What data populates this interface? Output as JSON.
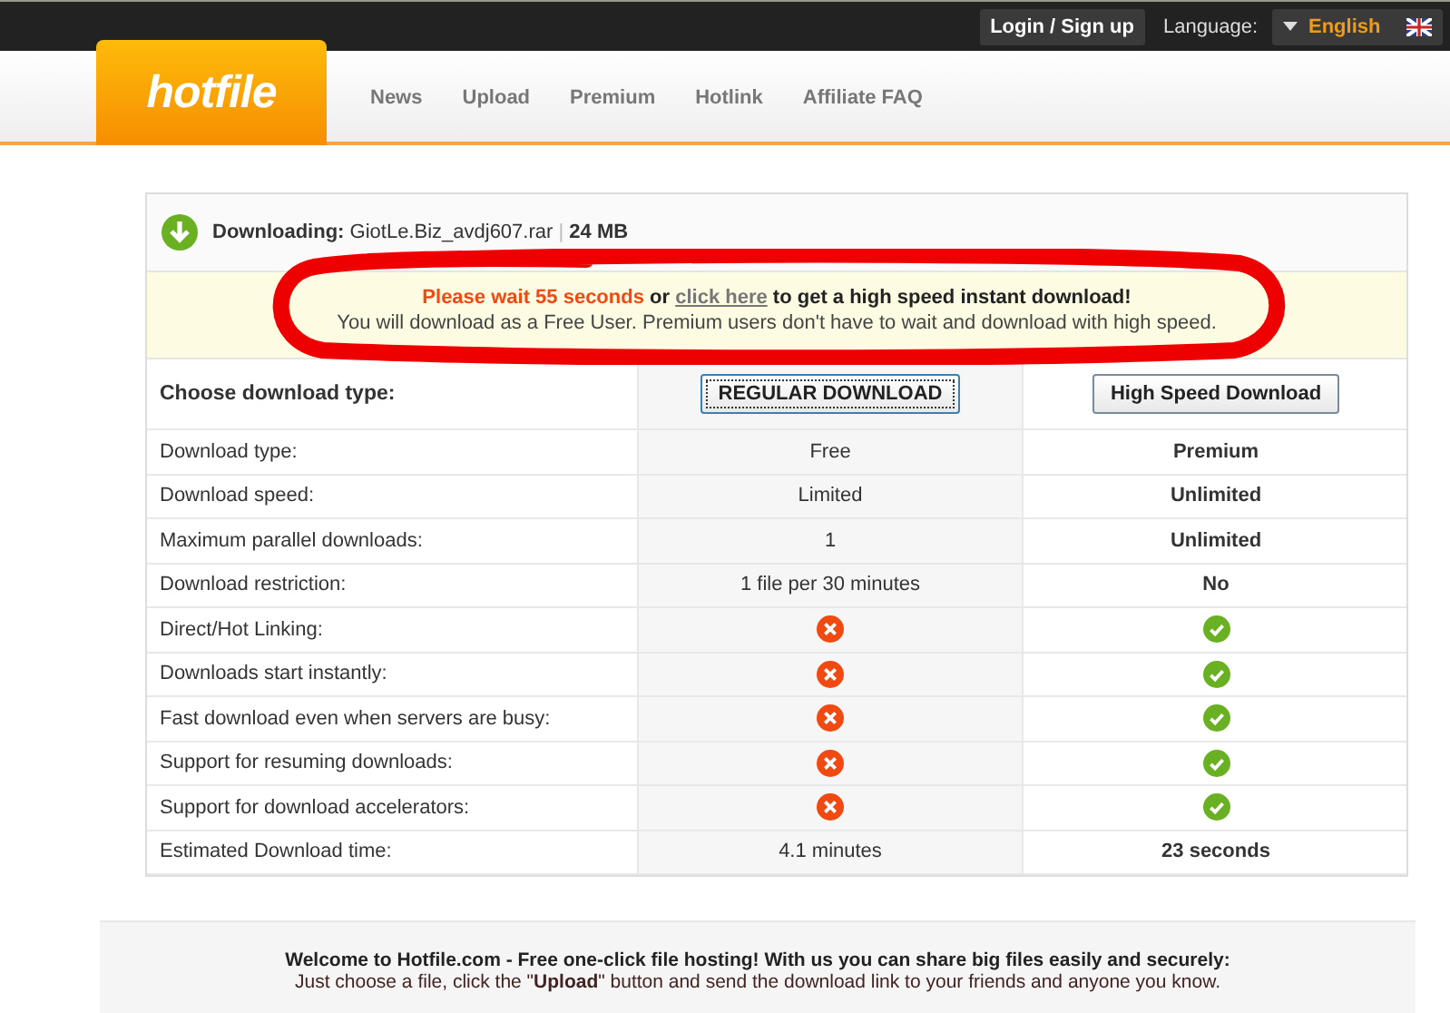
{
  "topbar": {
    "login": "Login / Sign up",
    "language_label": "Language:",
    "language": "English"
  },
  "logo": "hotfile",
  "nav": [
    "News",
    "Upload",
    "Premium",
    "Hotlink",
    "Affiliate FAQ"
  ],
  "download": {
    "label": "Downloading:",
    "filename": "GiotLe.Biz_avdj607.rar",
    "separator": "|",
    "size": "24 MB"
  },
  "notice": {
    "wait": "Please wait 55 seconds",
    "or": "or",
    "link": "click here",
    "rest": "to get a high speed instant download!",
    "line2": "You will download as a Free User. Premium users don't have to wait and download with high speed."
  },
  "choose": {
    "label": "Choose download type:",
    "buttons": [
      {
        "label": "REGULAR DOWNLOAD",
        "focused": true
      },
      {
        "label": "High Speed Download",
        "focused": false
      }
    ]
  },
  "rows": [
    {
      "label": "Download type:",
      "free": {
        "kind": "text",
        "text": "Free"
      },
      "premium": {
        "kind": "text",
        "text": "Premium"
      }
    },
    {
      "label": "Download speed:",
      "free": {
        "kind": "text",
        "text": "Limited"
      },
      "premium": {
        "kind": "text",
        "text": "Unlimited"
      }
    },
    {
      "label": "Maximum parallel downloads:",
      "free": {
        "kind": "text",
        "text": "1"
      },
      "premium": {
        "kind": "text",
        "text": "Unlimited"
      }
    },
    {
      "label": "Download restriction:",
      "free": {
        "kind": "text",
        "text": "1 file per 30 minutes"
      },
      "premium": {
        "kind": "text",
        "text": "No"
      }
    },
    {
      "label": "Direct/Hot Linking:",
      "free": {
        "kind": "no"
      },
      "premium": {
        "kind": "yes"
      }
    },
    {
      "label": "Downloads start instantly:",
      "free": {
        "kind": "no"
      },
      "premium": {
        "kind": "yes"
      }
    },
    {
      "label": "Fast download even when servers are busy:",
      "free": {
        "kind": "no"
      },
      "premium": {
        "kind": "yes"
      }
    },
    {
      "label": "Support for resuming downloads:",
      "free": {
        "kind": "no"
      },
      "premium": {
        "kind": "yes"
      }
    },
    {
      "label": "Support for download accelerators:",
      "free": {
        "kind": "no"
      },
      "premium": {
        "kind": "yes"
      }
    },
    {
      "label": "Estimated Download time:",
      "free": {
        "kind": "text",
        "text": "4.1 minutes"
      },
      "premium": {
        "kind": "text",
        "text": "23 seconds"
      }
    }
  ],
  "footer": {
    "title": "Welcome to Hotfile.com - Free one-click file hosting! With us you can share big files easily and securely:",
    "text": "Just choose a file, click the \"**Upload**\" button and send the download link to your friends and anyone you know."
  }
}
